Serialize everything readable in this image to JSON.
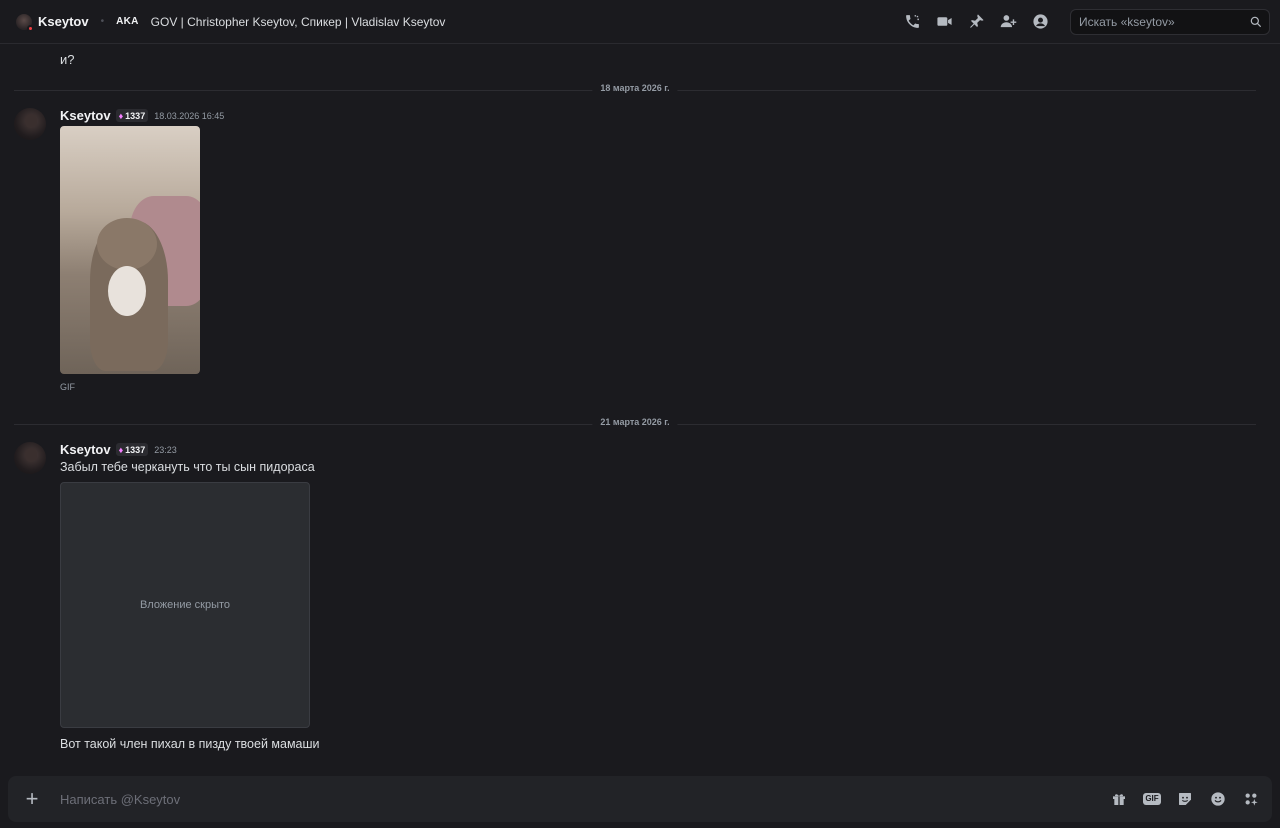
{
  "header": {
    "dm_name": "Kseytov",
    "separator": "•",
    "tag": "AKA",
    "nicknames": "GOV | Christopher Kseytov, Спикер | Vladislav Kseytov",
    "icons": [
      "phone-call-icon",
      "video-call-icon",
      "pin-icon",
      "add-friends-icon",
      "user-profile-icon"
    ],
    "search_placeholder": "Искать «kseytov»"
  },
  "messages": {
    "plain_line": "и?",
    "dividers": [
      "18 марта 2026 г.",
      "21 марта 2026 г."
    ],
    "items": [
      {
        "author": "Kseytov",
        "badge": "1337",
        "timestamp": "18.03.2026 16:45",
        "attachment_label": "GIF"
      },
      {
        "author": "Kseytov",
        "badge": "1337",
        "timestamp": "23:23",
        "text_1": "Забыл тебе черкануть что ты сын пидораса",
        "attachment_placeholder": "Вложение скрыто",
        "text_2": "Вот такой член пихал в пизду твоей мамаши"
      }
    ]
  },
  "composer": {
    "placeholder": "Написать @Kseytov",
    "icons": [
      "gift-icon",
      "gif-icon",
      "sticker-icon",
      "emoji-icon",
      "apps-icon"
    ],
    "gif_label": "GIF"
  }
}
